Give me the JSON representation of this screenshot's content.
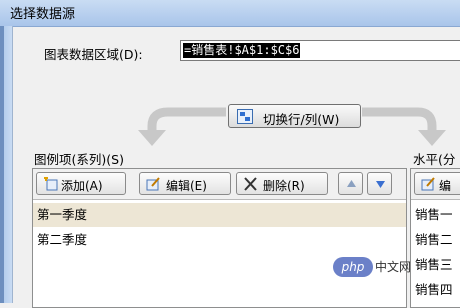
{
  "window": {
    "title": "选择数据源"
  },
  "range": {
    "label": "图表数据区域(D):",
    "value": "=销售表!$A$1:$C$6"
  },
  "switch_button": {
    "label": "切换行/列(W)"
  },
  "legend": {
    "title": "图例项(系列)(S)",
    "toolbar": {
      "add_label": "添加(A)",
      "edit_label": "编辑(E)",
      "delete_label": "删除(R)"
    },
    "items": [
      {
        "label": "第一季度",
        "selected": true
      },
      {
        "label": "第二季度",
        "selected": false
      }
    ]
  },
  "axis": {
    "title": "水平(分",
    "toolbar": {
      "edit_label": "编"
    },
    "items": [
      "销售一",
      "销售二",
      "销售三",
      "销售四"
    ]
  },
  "watermark": {
    "badge": "php",
    "text": "中文网"
  },
  "colors": {
    "titlebar": "#a9c5ea",
    "selected_row": "#ede6d5",
    "watermark": "#6b80c8"
  }
}
